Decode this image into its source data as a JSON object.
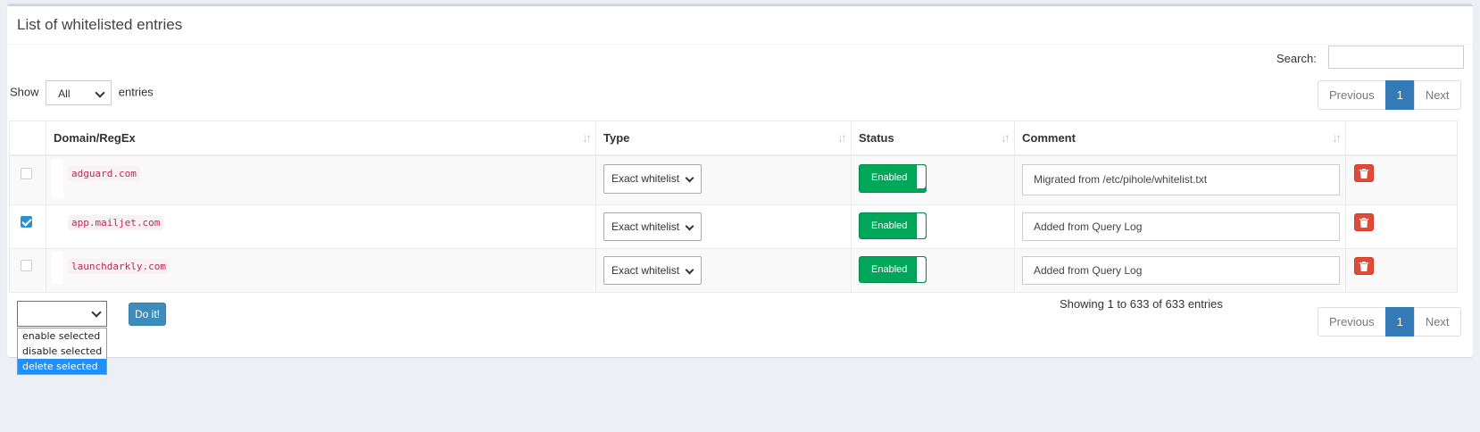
{
  "box": {
    "title": "List of whitelisted entries"
  },
  "search": {
    "label": "Search:",
    "value": ""
  },
  "length": {
    "show_label": "Show",
    "selected": "All",
    "entries_label": "entries"
  },
  "pager": {
    "previous": "Previous",
    "page": "1",
    "next": "Next"
  },
  "table": {
    "headers": [
      "Domain/RegEx",
      "Type",
      "Status",
      "Comment"
    ],
    "rows": [
      {
        "checked": false,
        "domain": "adguard.com",
        "type": "Exact whitelist",
        "status": "Enabled",
        "comment": "Migrated from /etc/pihole/whitelist.txt"
      },
      {
        "checked": true,
        "domain": "app.mailjet.com",
        "type": "Exact whitelist",
        "status": "Enabled",
        "comment": "Added from Query Log"
      },
      {
        "checked": false,
        "domain": "launchdarkly.com",
        "type": "Exact whitelist",
        "status": "Enabled",
        "comment": "Added from Query Log"
      }
    ]
  },
  "bulk": {
    "selected": "",
    "button": "Do it!",
    "options": [
      "enable selected",
      "disable selected",
      "delete selected"
    ],
    "highlighted_index": 2
  },
  "info": "Showing 1 to 633 of 633 entries",
  "colors": {
    "primary": "#337ab7",
    "success": "#00a65a",
    "danger": "#dd4b39",
    "code": "#c7254e"
  },
  "icons": {
    "sort": "sort-icon",
    "delete": "trash-icon",
    "checkbox": "checkbox-icon"
  }
}
